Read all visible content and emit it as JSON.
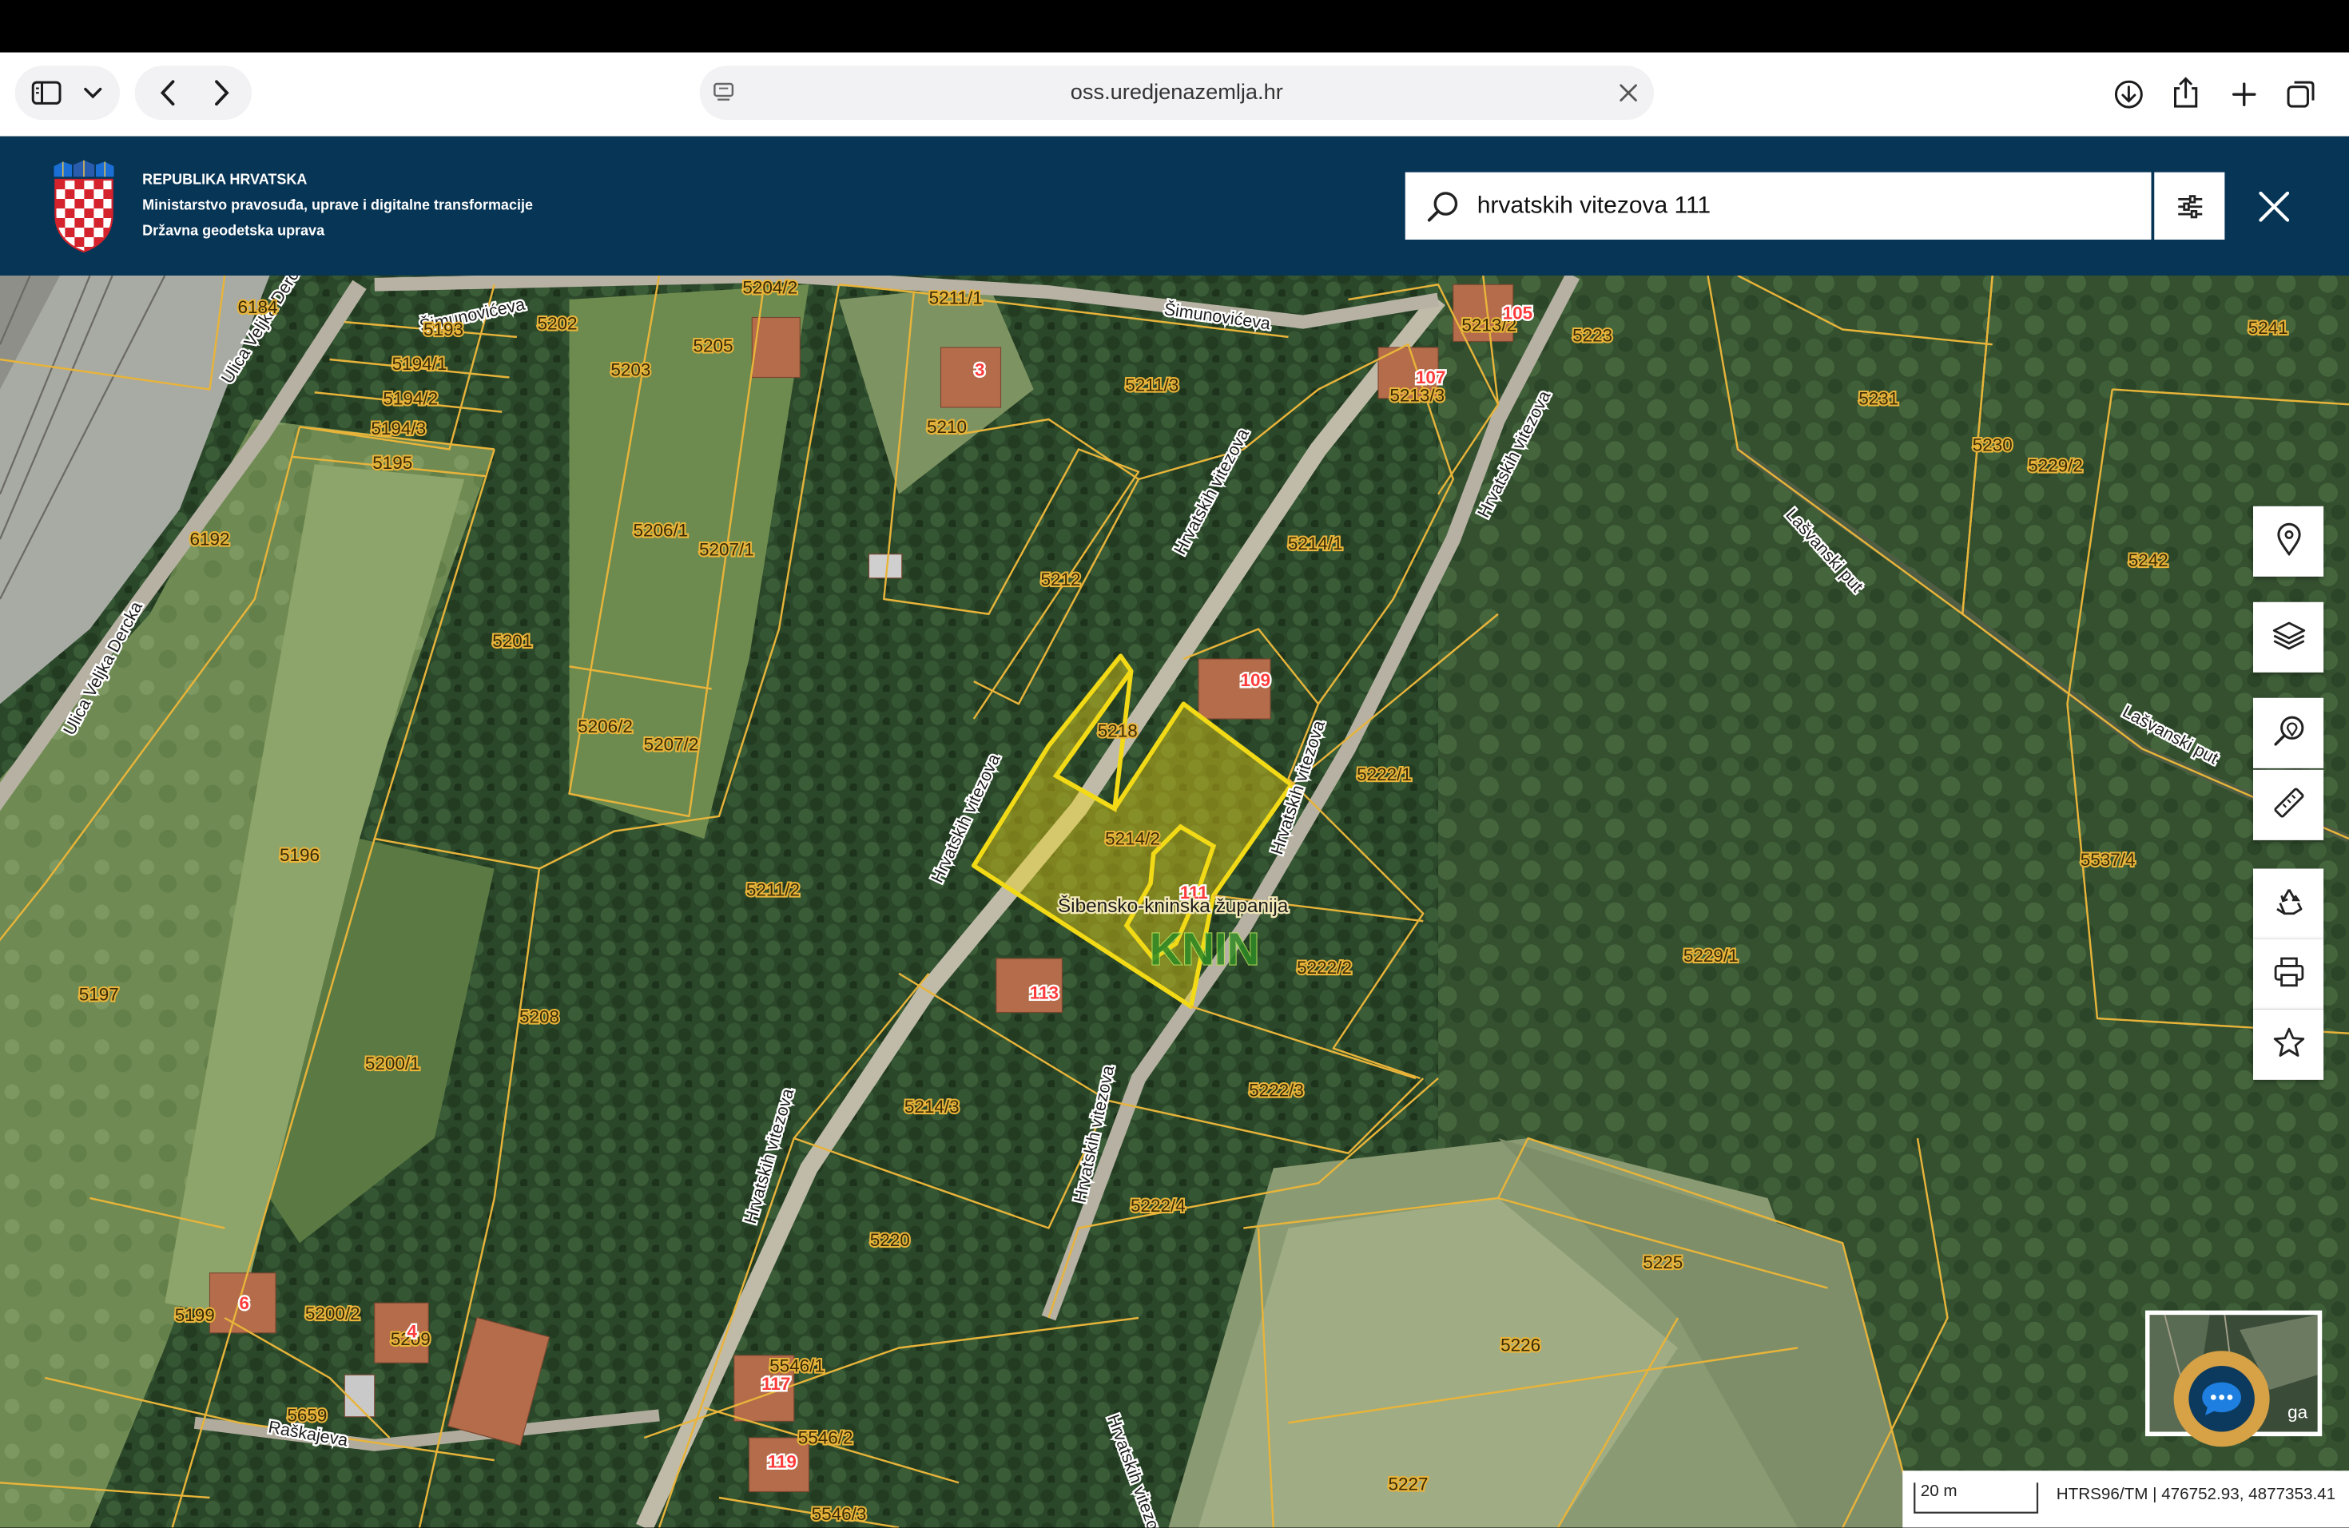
{
  "browser": {
    "url": "oss.uredjenazemlja.hr",
    "icons": [
      "sidebar-icon",
      "chevron-down-icon",
      "back-icon",
      "forward-icon",
      "page-icon",
      "clear-icon",
      "download-icon",
      "share-icon",
      "new-tab-icon",
      "tabs-icon"
    ]
  },
  "header": {
    "line1": "REPUBLIKA HRVATSKA",
    "line2": "Ministarstvo pravosuđa, uprave i digitalne transformacije",
    "line3": "Državna geodetska uprava",
    "colors": {
      "bar": "#073556",
      "text": "#ffffff"
    }
  },
  "search": {
    "query": "hrvatskih vitezova 111",
    "icons": [
      "search-icon",
      "filter-icon",
      "close-icon"
    ]
  },
  "map": {
    "parcels": [
      "6184",
      "5193",
      "5202",
      "5204/2",
      "5211/1",
      "5213/2",
      "5223",
      "5241",
      "5194/1",
      "5194/2",
      "5194/3",
      "5195",
      "5203",
      "5205",
      "5210",
      "5211/3",
      "5213/3",
      "5231",
      "5230",
      "5229/2",
      "6192",
      "5206/1",
      "5207/1",
      "5214/1",
      "5242",
      "5212",
      "5201",
      "5206/2",
      "5207/2",
      "5218",
      "5222/1",
      "5196",
      "5214/2",
      "5211/2",
      "5537/4",
      "5229/1",
      "5197",
      "5208",
      "5222/2",
      "5200/1",
      "5214/3",
      "5222/3",
      "5220",
      "5222/4",
      "5225",
      "5199",
      "5200/2",
      "5209",
      "5226",
      "5546/1",
      "5546/2",
      "5546/3",
      "5659",
      "5227"
    ],
    "house_numbers": [
      "105",
      "107",
      "3",
      "109",
      "111",
      "113",
      "6",
      "4",
      "117",
      "119"
    ],
    "streets": [
      "Šimunovićeva",
      "Šimunovićeva",
      "Ulica Veljka Dercka",
      "Ulica Veljka Dercka",
      "Hrvatskih vitezova",
      "Hrvatskih vitezova",
      "Hrvatskih vitezova",
      "Hrvatskih vitezova",
      "Hrvatskih vitezova",
      "Hrvatskih vitezova",
      "Hrvatskih vitezova",
      "Lašvanski put",
      "Lašvanski put",
      "Raškajeva"
    ],
    "county": "Šibensko-kninska županija",
    "town": "KNIN",
    "partial_label": "ga",
    "scale": "20 m",
    "coords": "HTRS96/TM | 476752.93, 4877353.41",
    "colors": {
      "parcel_line": "#e8b43a",
      "selection": "#f2da16",
      "house_label": "#ff3b3b",
      "parcel_label": "#3a2a05"
    },
    "tools": [
      "location-pin-icon",
      "layers-icon",
      "search-location-icon",
      "ruler-icon",
      "recycle-icon",
      "print-icon",
      "star-icon"
    ]
  },
  "chat": {
    "icon": "chat-bubble-icon"
  }
}
